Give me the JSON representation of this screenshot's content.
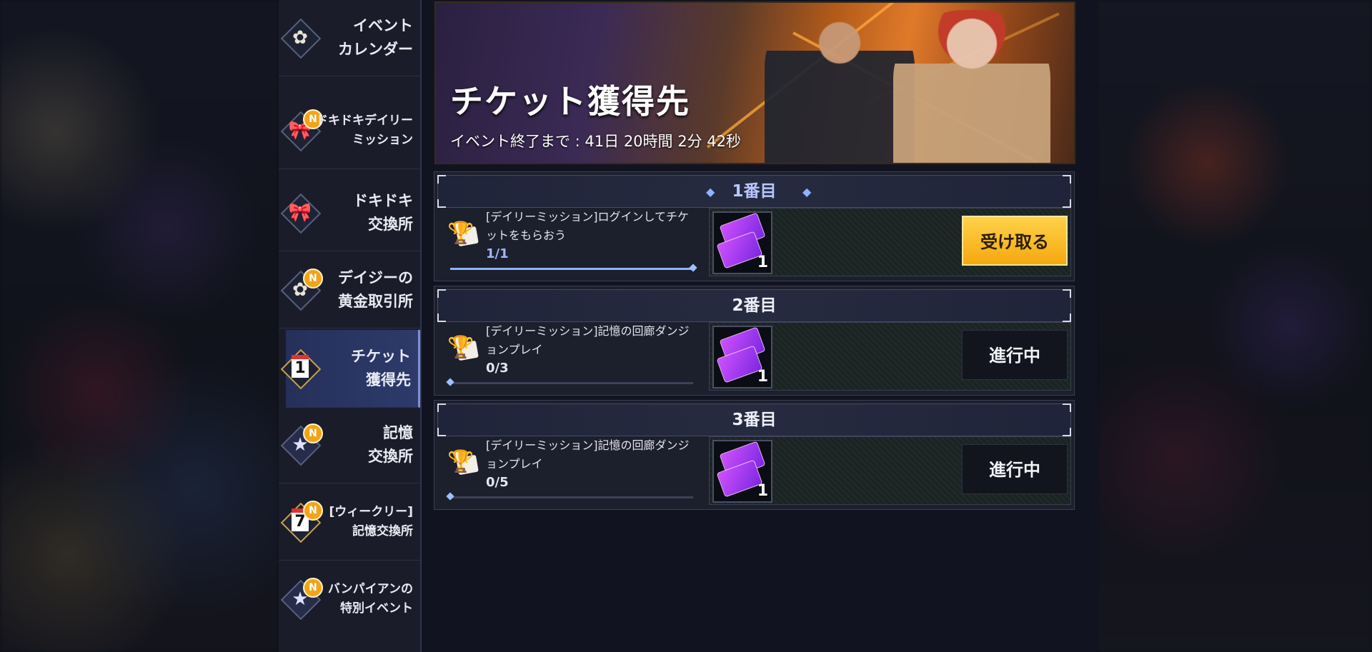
{
  "sidebar": {
    "items": [
      {
        "label": "イベント\nカレンダー",
        "icon": "medal-icon",
        "badge": false,
        "active": false
      },
      {
        "label": "ドキドキデイリー\nミッション",
        "icon": "ribbon-gift-icon",
        "badge": true,
        "active": false
      },
      {
        "label": "ドキドキ\n交換所",
        "icon": "ribbon-gift-icon",
        "badge": false,
        "active": false
      },
      {
        "label": "デイジーの\n黄金取引所",
        "icon": "medal-icon",
        "badge": true,
        "active": false
      },
      {
        "label": "チケット\n獲得先",
        "icon": "calendar-1-icon",
        "badge": false,
        "active": true
      },
      {
        "label": "記憶\n交換所",
        "icon": "star-icon",
        "badge": true,
        "active": false
      },
      {
        "label": "[ウィークリー]\n記憶交換所",
        "icon": "calendar-7-icon",
        "badge": true,
        "active": false
      },
      {
        "label": "バンパイアンの\n特別イベント",
        "icon": "star-icon",
        "badge": true,
        "active": false
      }
    ],
    "badge_text": "N",
    "calendar_1": "1",
    "calendar_7": "7"
  },
  "banner": {
    "title": "チケット獲得先",
    "timer": "イベント終了まで : 41日 20時間 2分 42秒"
  },
  "missions": [
    {
      "header": "1番目",
      "text": "[デイリーミッション]ログインしてチケットをもらおう",
      "progress_text": "1/1",
      "progress": 1.0,
      "reward_count": "1",
      "button": "受け取る",
      "state": "claimable"
    },
    {
      "header": "2番目",
      "text": "[デイリーミッション]記憶の回廊ダンジョンプレイ",
      "progress_text": "0/3",
      "progress": 0.0,
      "reward_count": "1",
      "button": "進行中",
      "state": "in_progress"
    },
    {
      "header": "3番目",
      "text": "[デイリーミッション]記憶の回廊ダンジョンプレイ",
      "progress_text": "0/5",
      "progress": 0.0,
      "reward_count": "1",
      "button": "進行中",
      "state": "in_progress"
    }
  ],
  "colors": {
    "accent": "#8fb3ff",
    "claim_button": "#f5b81c",
    "badge": "#f2a419"
  }
}
